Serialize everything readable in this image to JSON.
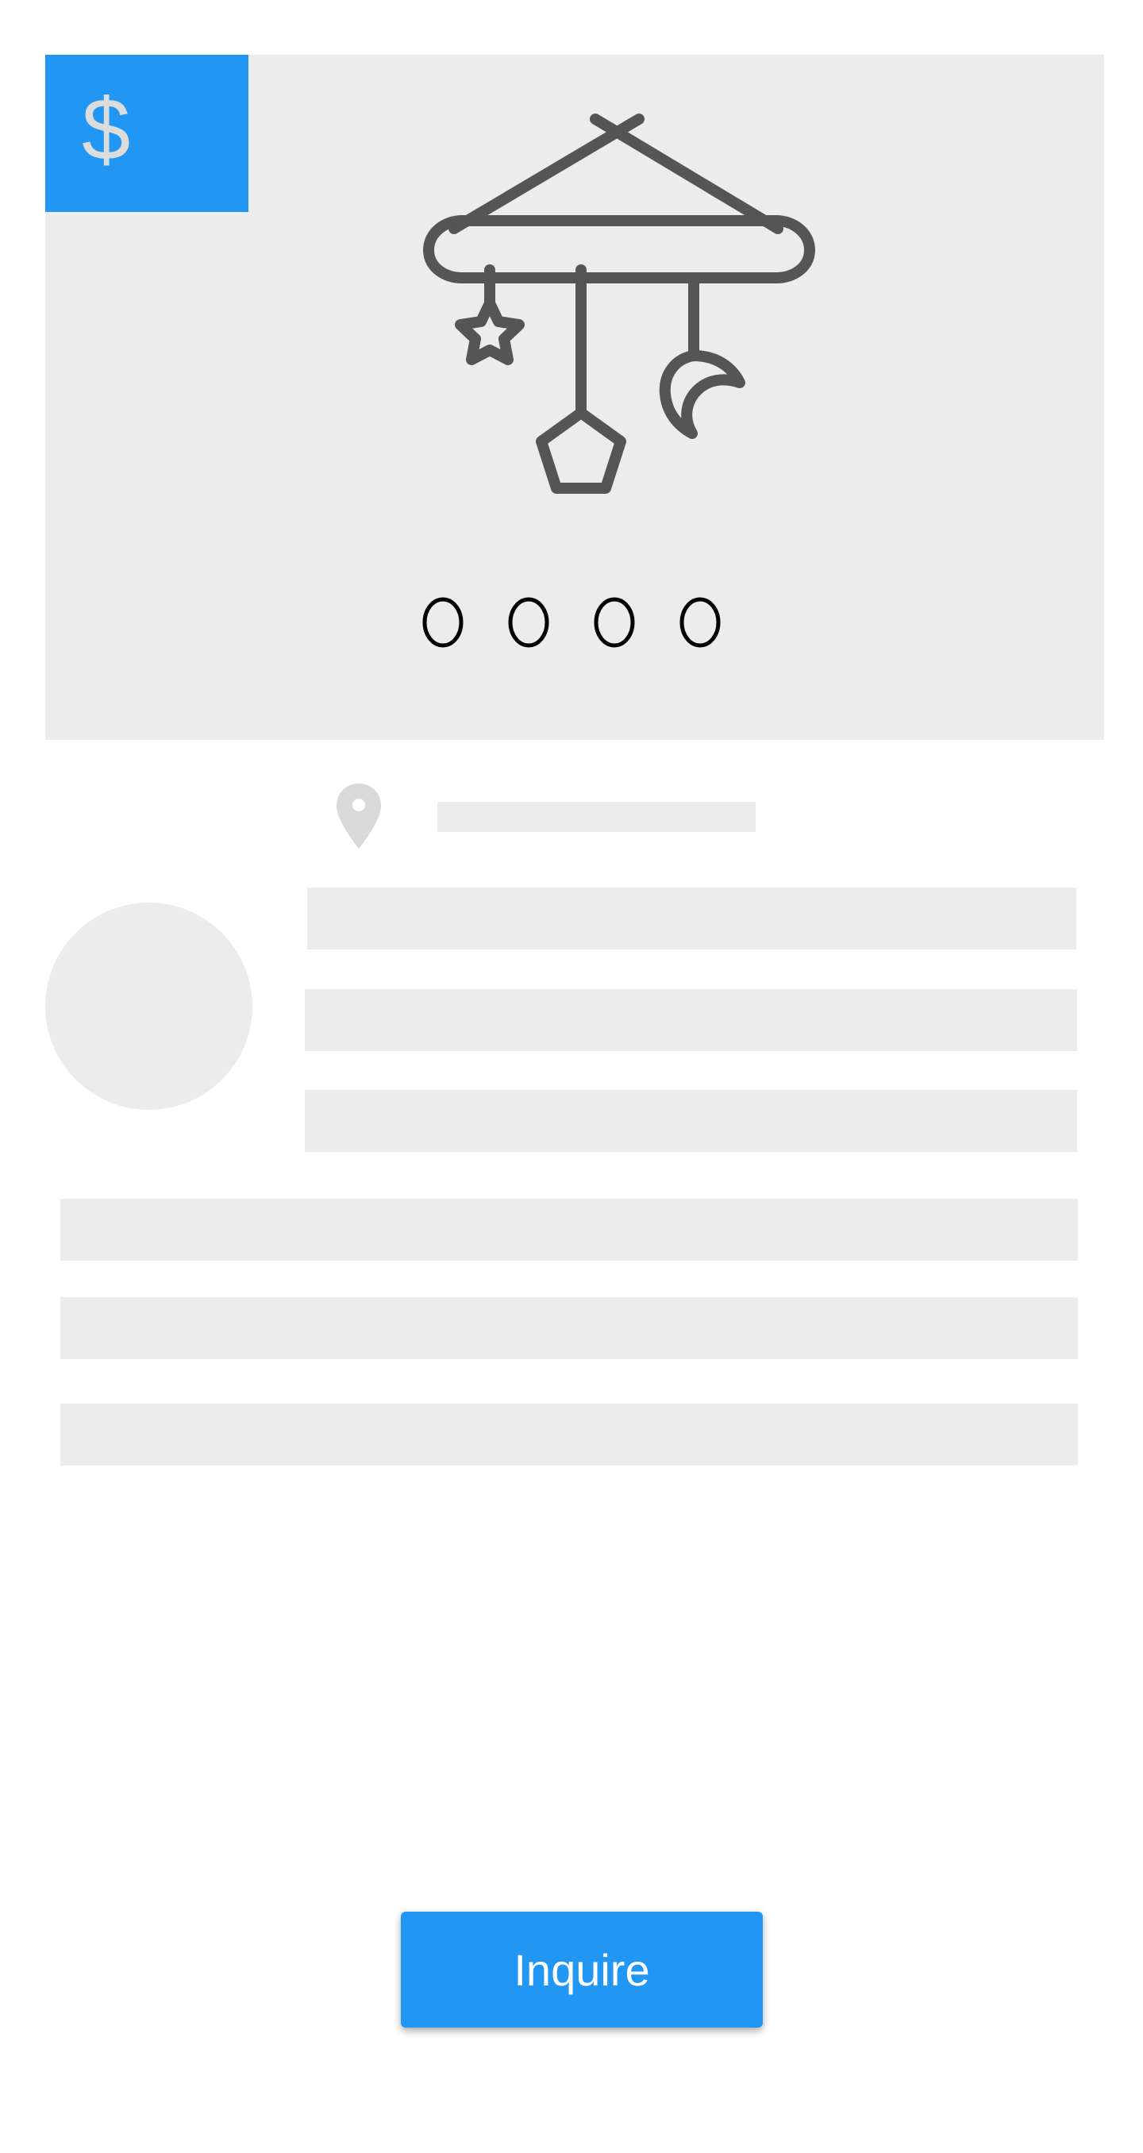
{
  "price_badge": {
    "symbol": "$",
    "color": "#2196f3",
    "symbol_icon": "dollar-icon"
  },
  "hero": {
    "image_icon": "baby-mobile-icon",
    "background": "#ececec",
    "pager": {
      "count": 4,
      "icon": "circle-outline-icon"
    }
  },
  "location": {
    "icon": "map-pin-icon"
  },
  "actions": {
    "inquire_label": "Inquire",
    "inquire_color": "#2196f3"
  },
  "placeholder_color": "#ececec"
}
